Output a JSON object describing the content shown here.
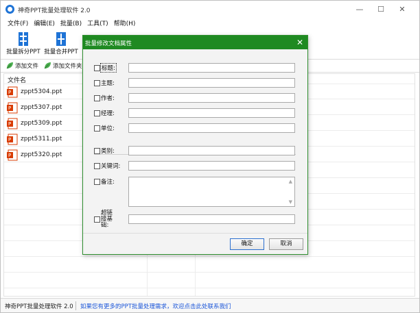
{
  "window": {
    "title": "神奇PPT批量处理软件 2.0",
    "controls": {
      "minimize": "—",
      "maximize": "☐",
      "close": "✕"
    }
  },
  "menu": [
    {
      "label": "文件(F)"
    },
    {
      "label": "编辑(E)"
    },
    {
      "label": "批量(B)"
    },
    {
      "label": "工具(T)"
    },
    {
      "label": "帮助(H)"
    }
  ],
  "toolbar": {
    "split": "批量拆分PPT",
    "merge": "批量合并PPT"
  },
  "subbar": {
    "add_file": "添加文件",
    "add_folder": "添加文件夹"
  },
  "list": {
    "header": "文件名",
    "files": [
      "zppt5304.ppt",
      "zppt5307.ppt",
      "zppt5309.ppt",
      "zppt5311.ppt",
      "zppt5320.ppt"
    ]
  },
  "status": {
    "app": "神奇PPT批量处理软件 2.0",
    "link": "如果您有更多的PPT批量处理需求，欢迎点击此处联系我们"
  },
  "dialog": {
    "title": "批量修改文档属性",
    "close": "✕",
    "fields": {
      "title": "标题:",
      "subject": "主题:",
      "author": "作者:",
      "manager": "经理:",
      "company": "单位:",
      "category": "类别:",
      "keywords": "关键词:",
      "comments": "备注:",
      "hyperlink": "超链接基础:"
    },
    "ok": "确定",
    "cancel": "取消"
  },
  "colors": {
    "dialog_title_bg": "#1f8a22",
    "accent_blue": "#1e73d6",
    "link": "#1a55d8",
    "ppt_icon": "#d83b01"
  }
}
